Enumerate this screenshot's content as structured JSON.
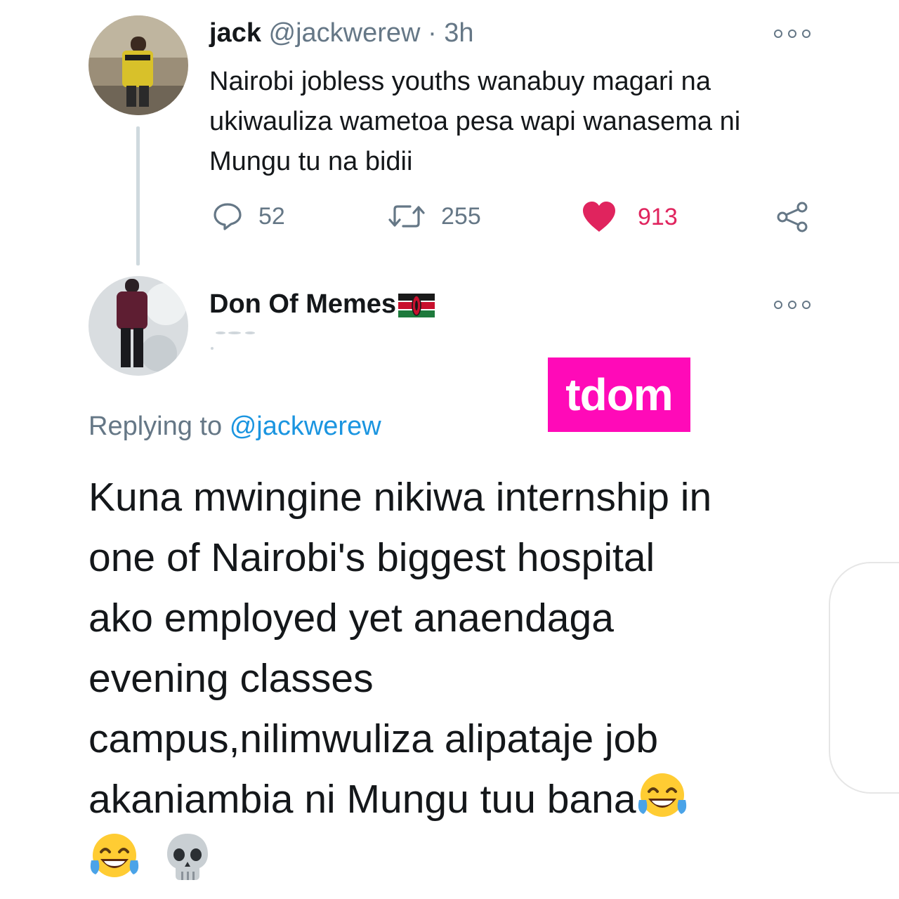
{
  "tweet1": {
    "display_name": "jack",
    "handle": "@jackwerew",
    "separator": "·",
    "time": "3h",
    "text": "Nairobi jobless youths wanabuy magari na ukiwauliza wametoa pesa wapi wanasema ni Mungu tu na bidii",
    "reply_count": "52",
    "retweet_count": "255",
    "like_count": "913",
    "liked": true,
    "icons": {
      "reply": "reply-icon",
      "retweet": "retweet-icon",
      "like": "heart-icon",
      "share": "share-icon",
      "more": "more-icon"
    }
  },
  "tweet2": {
    "display_name": "Don Of Memes",
    "flag_icon": "kenya-flag-icon",
    "replying_label": "Replying to",
    "replying_mention": "@jackwerew",
    "text_lines": [
      "Kuna mwingine nikiwa internship in",
      "one of Nairobi's biggest hospital",
      "ako employed yet anaendaga",
      "evening classes",
      "campus,nilimwuliza alipataje job",
      "akaniambia ni Mungu tuu bana"
    ],
    "trailing_emojis": [
      "face-with-tears-of-joy",
      "face-with-tears-of-joy",
      "skull"
    ]
  },
  "watermark": {
    "text": "tdom"
  },
  "colors": {
    "text": "#14171a",
    "secondary": "#657786",
    "link": "#1b95e0",
    "like": "#e0245e",
    "watermark_bg": "#ff0ab8",
    "thread_line": "#cfd9de"
  }
}
